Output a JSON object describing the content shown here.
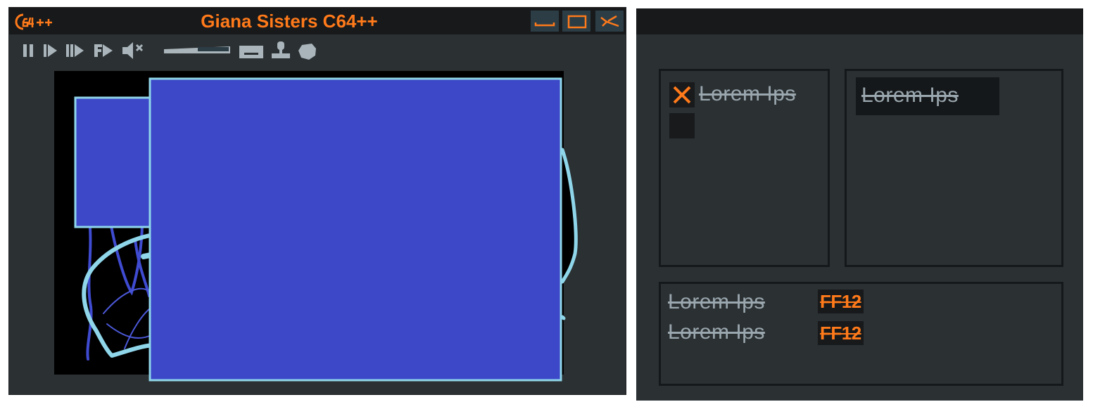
{
  "window": {
    "title": "Giana Sisters C64++",
    "logo_text": "C64++",
    "controls": {
      "minimize": "minimize-icon",
      "maximize": "maximize-icon",
      "close": "close-icon"
    }
  },
  "toolbar": {
    "icons": [
      "pause-icon",
      "play-icon",
      "step-forward-icon",
      "fast-forward-icon",
      "mute-icon",
      "volume-slider",
      "screenshot-icon",
      "joystick-icon",
      "record-icon"
    ]
  },
  "settings": {
    "group1": {
      "checkbox1": {
        "label": "Lorem Ips",
        "checked": true
      },
      "checkbox2": {
        "label": "",
        "checked": false
      }
    },
    "group2": {
      "dropdown": {
        "value": "Lorem Ips"
      }
    },
    "group3": {
      "rows": [
        {
          "label": "Lorem Ips",
          "value": "FF12"
        },
        {
          "label": "Lorem Ips",
          "value": "FF12"
        }
      ]
    }
  },
  "colors": {
    "accent": "#ff7a1a",
    "panel_bg": "#2b3033",
    "titlebar_bg": "#17191b",
    "label": "#9aa7ae",
    "screen_blue": "#3c48c8",
    "screen_outline": "#8fd6ea"
  }
}
